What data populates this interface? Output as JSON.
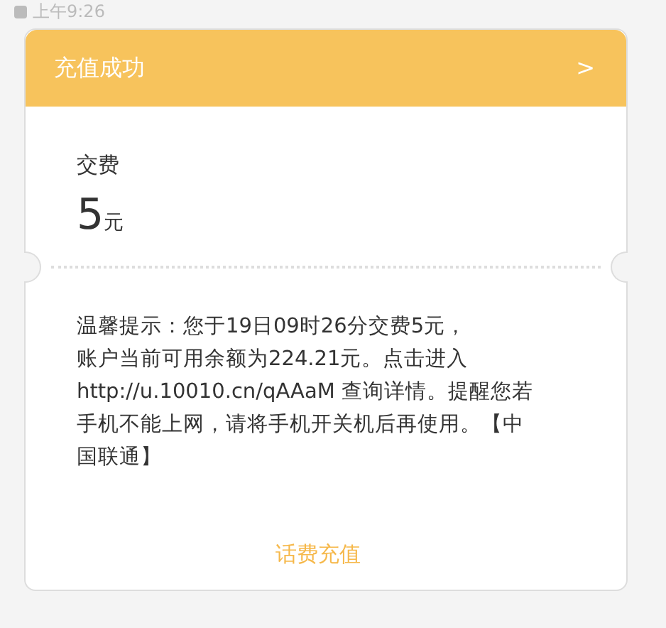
{
  "status_bar": {
    "time": "上午9:26"
  },
  "card": {
    "title": "充值成功",
    "chevron": ">",
    "fee_label": "交费",
    "amount": "5",
    "unit": "元",
    "message_lines": [
      "温馨提示：您于19日09时26分交费5元，",
      "账户当前可用余额为224.21元。点击进入",
      "http://u.10010.cn/qAAaM 查询详情。提醒您若",
      "手机不能上网，请将手机开关机后再使用。【中",
      "国联通】"
    ],
    "action": "话费充值"
  }
}
